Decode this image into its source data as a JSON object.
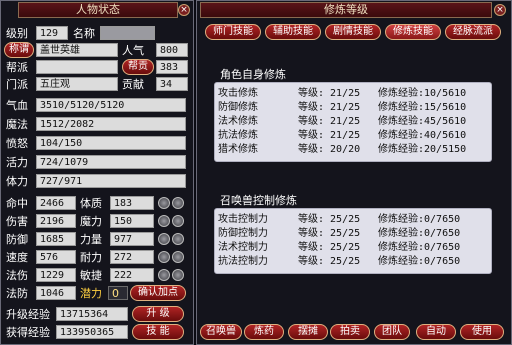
{
  "left": {
    "title": "人物状态",
    "rows": {
      "grade_label": "级别",
      "grade": "129",
      "name_label": "名称",
      "title_label": "称谓",
      "title_value": "盖世英雄",
      "pop_label": "人气",
      "pop": "800",
      "gang_label": "帮派",
      "gang_button": "帮贡",
      "gang_contrib": "383",
      "school_label": "门派",
      "school": "五庄观",
      "contrib_label": "贡献",
      "contrib": "34",
      "hp_label": "气血",
      "hp": "3510/5120/5120",
      "mp_label": "魔法",
      "mp": "1512/2082",
      "rage_label": "愤怒",
      "rage": "104/150",
      "vit_label": "活力",
      "vit": "724/1079",
      "sta_label": "体力",
      "sta": "727/971"
    },
    "stats": [
      {
        "l1": "命中",
        "v1": "2466",
        "l2": "体质",
        "v2": "183"
      },
      {
        "l1": "伤害",
        "v1": "2196",
        "l2": "魔力",
        "v2": "150"
      },
      {
        "l1": "防御",
        "v1": "1685",
        "l2": "力量",
        "v2": "977"
      },
      {
        "l1": "速度",
        "v1": "576",
        "l2": "耐力",
        "v2": "272"
      },
      {
        "l1": "法伤",
        "v1": "1229",
        "l2": "敏捷",
        "v2": "222"
      }
    ],
    "res_label": "法防",
    "res": "1046",
    "pot_label": "潜力",
    "pot": "0",
    "confirm_button": "确认加点",
    "upexp_label": "升级经验",
    "upexp": "13715364",
    "up_button": "升 级",
    "getexp_label": "获得经验",
    "getexp": "133950365",
    "skill_button": "技 能"
  },
  "right": {
    "title": "修炼等级",
    "tabs": [
      "师门技能",
      "辅助技能",
      "剧情技能",
      "修炼技能",
      "经脉流派"
    ],
    "self_title": "角色自身修炼",
    "self": [
      {
        "name": "攻击修炼",
        "grade": "等级: 21/25",
        "exp": "修炼经验:10/5610"
      },
      {
        "name": "防御修炼",
        "grade": "等级: 21/25",
        "exp": "修炼经验:15/5610"
      },
      {
        "name": "法术修炼",
        "grade": "等级: 21/25",
        "exp": "修炼经验:45/5610"
      },
      {
        "name": "抗法修炼",
        "grade": "等级: 21/25",
        "exp": "修炼经验:40/5610"
      },
      {
        "name": "猎术修炼",
        "grade": "等级: 20/20",
        "exp": "修炼经验:20/5150"
      }
    ],
    "pet_title": "召唤兽控制修炼",
    "pet": [
      {
        "name": "攻击控制力",
        "grade": "等级: 25/25",
        "exp": "修炼经验:0/7650"
      },
      {
        "name": "防御控制力",
        "grade": "等级: 25/25",
        "exp": "修炼经验:0/7650"
      },
      {
        "name": "法术控制力",
        "grade": "等级: 25/25",
        "exp": "修炼经验:0/7650"
      },
      {
        "name": "抗法控制力",
        "grade": "等级: 25/25",
        "exp": "修炼经验:0/7650"
      }
    ],
    "bottom": [
      "召唤兽",
      "炼药",
      "摆摊",
      "拍卖",
      "团队",
      "自动",
      "使用"
    ]
  },
  "close_glyph": "×"
}
